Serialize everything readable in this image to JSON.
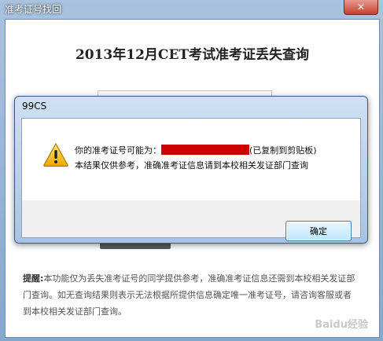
{
  "window": {
    "title": "准考证号找回",
    "close_label": "✕"
  },
  "main": {
    "title": "2013年12月CET考试准考证丢失查询",
    "field_label": "",
    "tips_label": "提醒:",
    "tips_text": "本功能仅为丢失准考证号的同学提供参考，准确准考证信息还需到本校相关发证部门查询。如无查询结果则表示无法根据所提供信息确定唯一准考证号，请咨询客服或者到本校相关发证部门查询。"
  },
  "dialog": {
    "title": "99CS",
    "message_prefix": "你的准考证号可能为：",
    "message_suffix": "(已复制到剪贴板)",
    "message_line2": "本结果仅供参考，准确准考证信息请到本校相关发证部门查询",
    "ok_label": "确定",
    "icon": "warning-icon"
  },
  "watermark": "Baidu经验",
  "colors": {
    "redaction": "#cc0000",
    "warning_yellow": "#f2c21b"
  }
}
